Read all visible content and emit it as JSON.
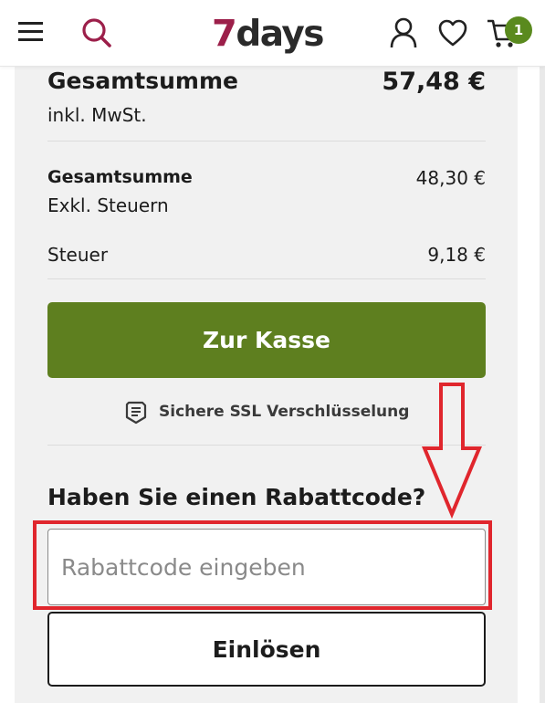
{
  "header": {
    "logo_number": "7",
    "logo_word": "days",
    "cart_count": "1",
    "icons": {
      "menu": "menu-icon",
      "search": "search-icon",
      "account": "user-icon",
      "wishlist": "heart-icon",
      "cart": "cart-icon"
    },
    "colors": {
      "logo_accent": "#9c1f4a",
      "badge": "#5a8a1e"
    }
  },
  "summary": {
    "total_label": "Gesamtsumme",
    "total_value": "57,48 €",
    "total_note": "inkl. MwSt.",
    "net_label": "Gesamtsumme",
    "net_value": "48,30 €",
    "net_note": "Exkl. Steuern",
    "tax_label": "Steuer",
    "tax_value": "9,18 €"
  },
  "checkout": {
    "button_label": "Zur Kasse",
    "button_color": "#5e7f1f",
    "ssl_text": "Sichere SSL Verschlüsselung",
    "ssl_icon": "shield-icon"
  },
  "coupon": {
    "title": "Haben Sie einen Rabattcode?",
    "placeholder": "Rabattcode eingeben",
    "value": "",
    "redeem_label": "Einlösen"
  },
  "annotation": {
    "color": "#e0262d",
    "arrow_direction": "down"
  }
}
